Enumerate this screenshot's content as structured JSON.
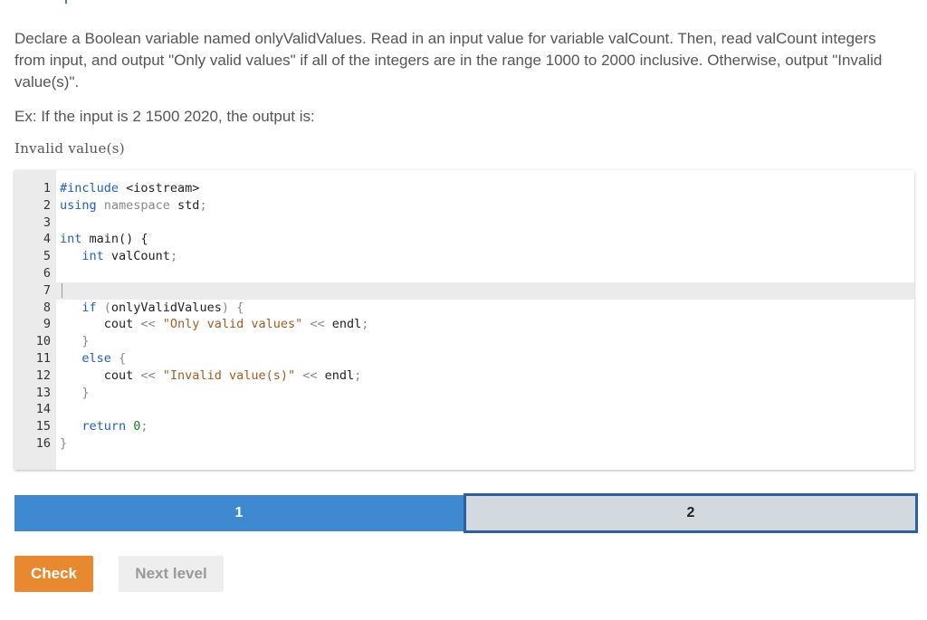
{
  "prompt": {
    "text": "Declare a Boolean variable named onlyValidValues. Read in an input value for variable valCount. Then, read valCount integers from input, and output \"Only valid values\" if all of the integers are in the range 1000 to 2000 inclusive. Otherwise, output \"Invalid value(s)\".",
    "example": "Ex: If the input is 2 1500 2020, the output is:",
    "sample_output": "Invalid value(s)"
  },
  "code": {
    "line_numbers": [
      "1",
      "2",
      "3",
      "4",
      "5",
      "6",
      "7",
      "8",
      "9",
      "10",
      "11",
      "12",
      "13",
      "14",
      "15",
      "16"
    ],
    "l1_a": "#include",
    "l1_b": " <iostream>",
    "l2_a": "using",
    "l2_b": " namespace",
    "l2_c": " std",
    "l2_d": ";",
    "l4_a": "int",
    "l4_b": " main",
    "l4_c": "() {",
    "l5_a": "   int",
    "l5_b": " valCount",
    "l5_c": ";",
    "l8_a": "   if",
    "l8_b": " (",
    "l8_c": "onlyValidValues",
    "l8_d": ") {",
    "l9_a": "      cout",
    "l9_b": " <<",
    "l9_c": " \"Only valid values\"",
    "l9_d": " <<",
    "l9_e": " endl",
    "l9_f": ";",
    "l10_a": "   }",
    "l11_a": "   else",
    "l11_b": " {",
    "l12_a": "      cout",
    "l12_b": " <<",
    "l12_c": " \"Invalid value(s)\"",
    "l12_d": " <<",
    "l12_e": " endl",
    "l12_f": ";",
    "l13_a": "   }",
    "l15_a": "   return",
    "l15_b": " 0",
    "l15_c": ";",
    "l16_a": "}"
  },
  "levels": {
    "level1": "1",
    "level2": "2"
  },
  "buttons": {
    "check": "Check",
    "next_level": "Next level"
  }
}
